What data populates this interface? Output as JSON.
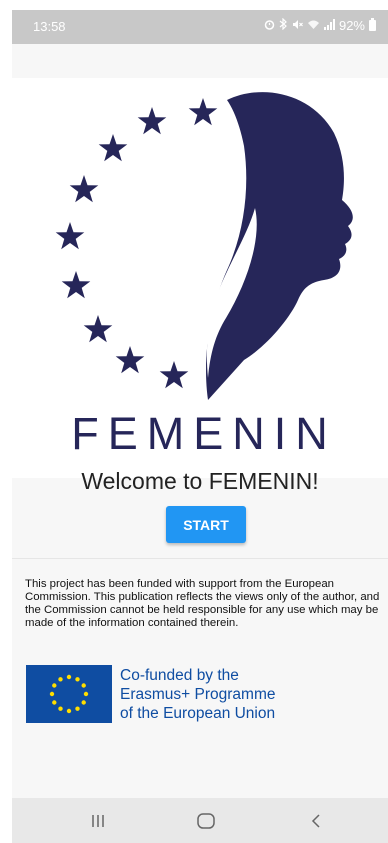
{
  "status_bar": {
    "time": "13:58",
    "battery": "92%",
    "icons": [
      "alarm-icon",
      "bluetooth-icon",
      "mute-icon",
      "wifi-icon",
      "signal-icon",
      "battery-icon"
    ]
  },
  "logo": {
    "wordmark": "FEMENIN",
    "colors": {
      "navy": "#262659"
    }
  },
  "welcome": {
    "title": "Welcome to FEMENIN!",
    "start_label": "START"
  },
  "disclaimer": {
    "text": "This project has been funded with support from the European Commission. This publication reflects the views only of the author, and the Commission cannot be held responsible for any use which may be made of the information contained therein."
  },
  "eu_funding": {
    "line1": "Co-funded by the",
    "line2": "Erasmus+ Programme",
    "line3": "of the European Union",
    "colors": {
      "blue": "#0f4da2",
      "star": "#ffde00"
    }
  },
  "nav_bar": {
    "items": [
      "recent-apps-icon",
      "home-icon",
      "back-icon"
    ]
  },
  "colors": {
    "primary_button": "#2196f3",
    "status_bar_bg": "#c8c8c8",
    "page_bg": "#f7f7f7"
  }
}
